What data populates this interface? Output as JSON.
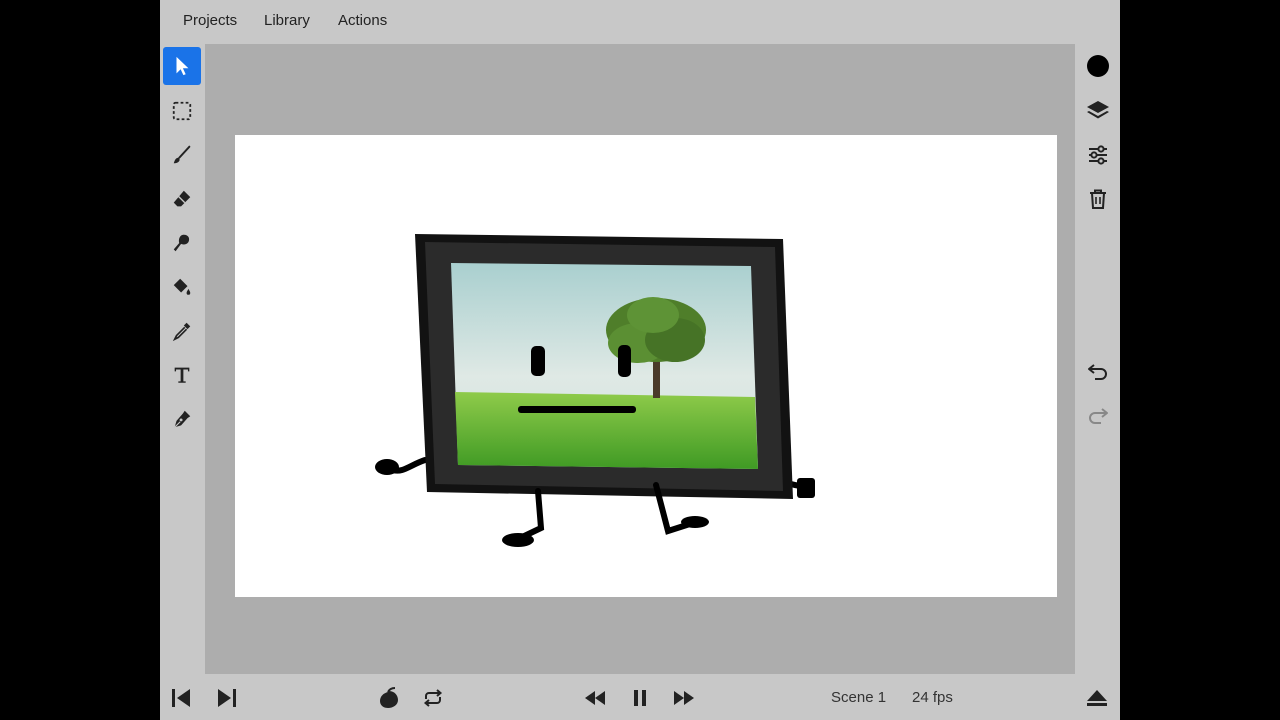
{
  "menu": {
    "projects": "Projects",
    "library": "Library",
    "actions": "Actions"
  },
  "tools": [
    {
      "name": "select",
      "icon": "arrow-pointer-icon",
      "active": true
    },
    {
      "name": "marquee-select",
      "icon": "dashed-square-icon"
    },
    {
      "name": "brush",
      "icon": "brush-icon"
    },
    {
      "name": "eraser",
      "icon": "eraser-icon"
    },
    {
      "name": "smudge",
      "icon": "smudge-icon"
    },
    {
      "name": "fill",
      "icon": "paint-bucket-icon"
    },
    {
      "name": "eyedropper",
      "icon": "eyedropper-icon"
    },
    {
      "name": "text",
      "icon": "text-icon"
    },
    {
      "name": "pen",
      "icon": "pen-nib-icon"
    }
  ],
  "right_tools": {
    "color": "#000000",
    "items": [
      "color-swatch-icon",
      "layers-icon",
      "sliders-icon",
      "trash-icon",
      "undo-icon",
      "redo-icon"
    ]
  },
  "playback": {
    "scene": "Scene 1",
    "fps": "24 fps",
    "buttons": [
      "previous-frame-icon",
      "next-frame-icon",
      "onion-skin-icon",
      "loop-icon",
      "rewind-icon",
      "pause-icon",
      "fast-forward-icon",
      "eject-icon"
    ]
  },
  "canvas": {
    "background": "#ffffff",
    "artwork": "picture-frame-character"
  },
  "colors": {
    "accent": "#1a73e8",
    "chrome": "#c8c8c8",
    "workspace": "#adadad"
  }
}
